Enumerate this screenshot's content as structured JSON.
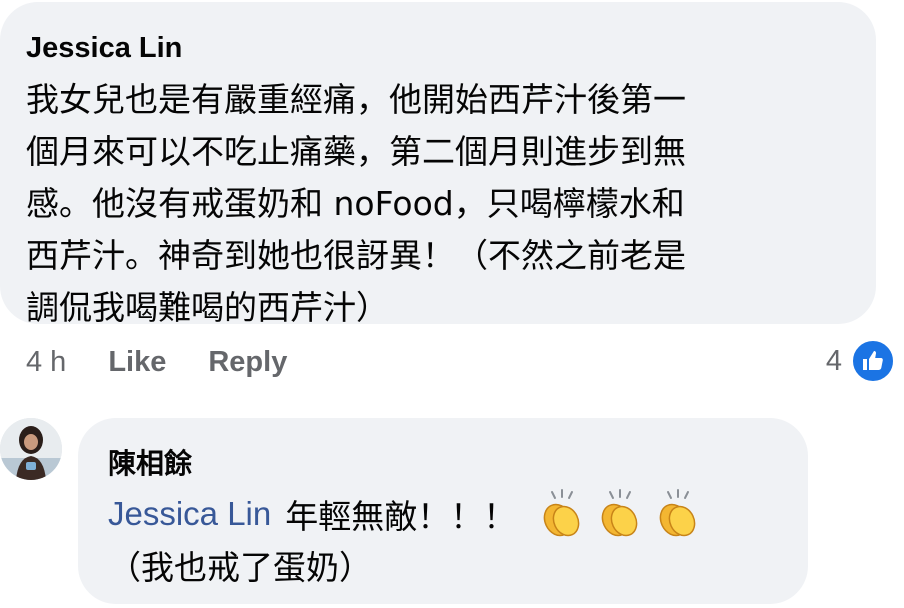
{
  "comment": {
    "author": "Jessica Lin",
    "text": "我女兒也是有嚴重經痛，他開始西芹汁後第一\n個月來可以不吃止痛藥，第二個月則進步到無\n感。他沒有戒蛋奶和 noFood，只喝檸檬水和\n西芹汁。神奇到她也很訝異！（不然之前老是\n調侃我喝難喝的西芹汁）",
    "time": "4 h",
    "like_label": "Like",
    "reply_label": "Reply",
    "reaction_count": "4",
    "reaction_icon": "like-icon",
    "reaction_color": "#1b74e4"
  },
  "reply": {
    "author": "陳相餘",
    "mention": "Jessica Lin",
    "text": "年輕無敵！！！",
    "emoji": [
      "clapping-hands-icon",
      "clapping-hands-icon",
      "clapping-hands-icon"
    ],
    "text2": "（我也戒了蛋奶）",
    "mention_color": "#385898"
  }
}
